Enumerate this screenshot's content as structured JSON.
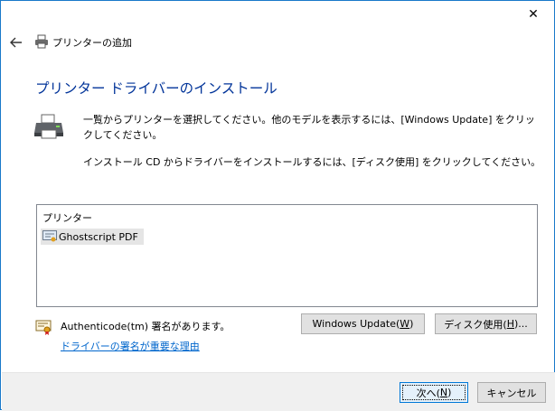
{
  "window": {
    "close_glyph": "✕",
    "nav_title": "プリンターの追加"
  },
  "main": {
    "heading": "プリンター ドライバーのインストール",
    "instruction_1": "一覧からプリンターを選択してください。他のモデルを表示するには、[Windows Update] をクリックしてください。",
    "instruction_2": "インストール CD からドライバーをインストールするには、[ディスク使用] をクリックしてください。"
  },
  "printer_list": {
    "header": "プリンター",
    "items": [
      {
        "label": "Ghostscript PDF",
        "selected": true
      }
    ]
  },
  "signature": {
    "status": "Authenticode(tm) 署名があります。",
    "link": "ドライバーの署名が重要な理由"
  },
  "buttons": {
    "windows_update": {
      "label": "Windows Update(",
      "accel": "W",
      "suffix": ")"
    },
    "have_disk": {
      "label": "ディスク使用(",
      "accel": "H",
      "suffix": ")..."
    },
    "next": {
      "label": "次へ(",
      "accel": "N",
      "suffix": ")"
    },
    "cancel": "キャンセル"
  },
  "icons": {
    "close": "close-icon",
    "back": "back-arrow-icon",
    "printer": "printer-icon",
    "certificate": "certificate-icon"
  },
  "colors": {
    "heading": "#003399",
    "link": "#0066cc",
    "window_border": "#1979ca",
    "footer_bg": "#f0f0f0",
    "selected_item_bg": "#e5e5e5"
  }
}
